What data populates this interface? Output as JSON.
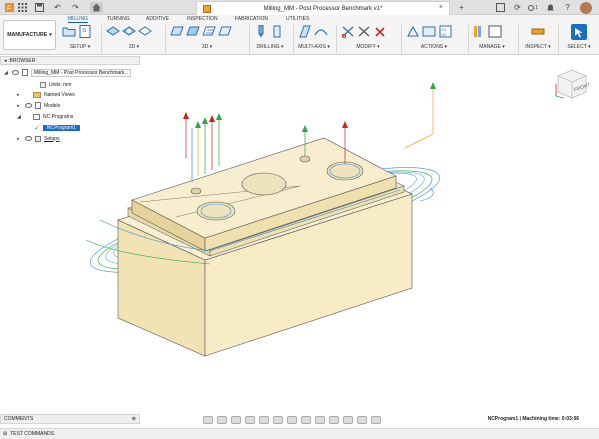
{
  "titlebar": {
    "doc_title": "Milling_MM - Post Processor Benchmark v1*",
    "counter_badge": "1",
    "clock_text": "1"
  },
  "ribbon": {
    "workspace": "MANUFACTURE",
    "tabs": [
      "MILLING",
      "TURNING",
      "ADDITIVE",
      "INSPECTION",
      "FABRICATION",
      "UTILITIES"
    ],
    "groups": {
      "setup": "SETUP",
      "g2d": "2D",
      "g3d": "3D",
      "drilling": "DRILLING",
      "multiaxis": "MULTI-AXIS",
      "modify": "MODIFY",
      "actions": "ACTIONS",
      "manage": "MANAGE",
      "inspect": "INSPECT",
      "select": "SELECT"
    }
  },
  "browser": {
    "header": "BROWSER",
    "root": "Milling_MM - Post Processor Benchmark...",
    "units": "Units: mm",
    "named_views": "Named Views",
    "models": "Models",
    "nc_programs": "NC Programs",
    "nc_program1": "NCProgram1",
    "setups": "Setups"
  },
  "viewcube": {
    "face": "FRONT"
  },
  "bottom": {
    "comments": "COMMENTS",
    "test_commands": "TEST COMMANDS",
    "status": "NCProgram1 | Machining time: 0:03:06"
  },
  "colors": {
    "accent": "#1a6fc4",
    "part": "#f5e9c0",
    "part_dark": "#e9d9a5",
    "toolpath_green": "#2aa84a",
    "toolpath_blue": "#3a8ed6",
    "arrow_red": "#d02020"
  },
  "icons": [
    "cube-icon",
    "grid-icon",
    "save-icon",
    "undo-icon",
    "redo-icon",
    "home-icon",
    "close-icon",
    "add-tab-icon",
    "help-icon",
    "bell-icon",
    "user-avatar-icon",
    "eye-icon",
    "folder-icon",
    "gear-icon",
    "pan-icon",
    "orbit-icon",
    "zoom-icon"
  ]
}
